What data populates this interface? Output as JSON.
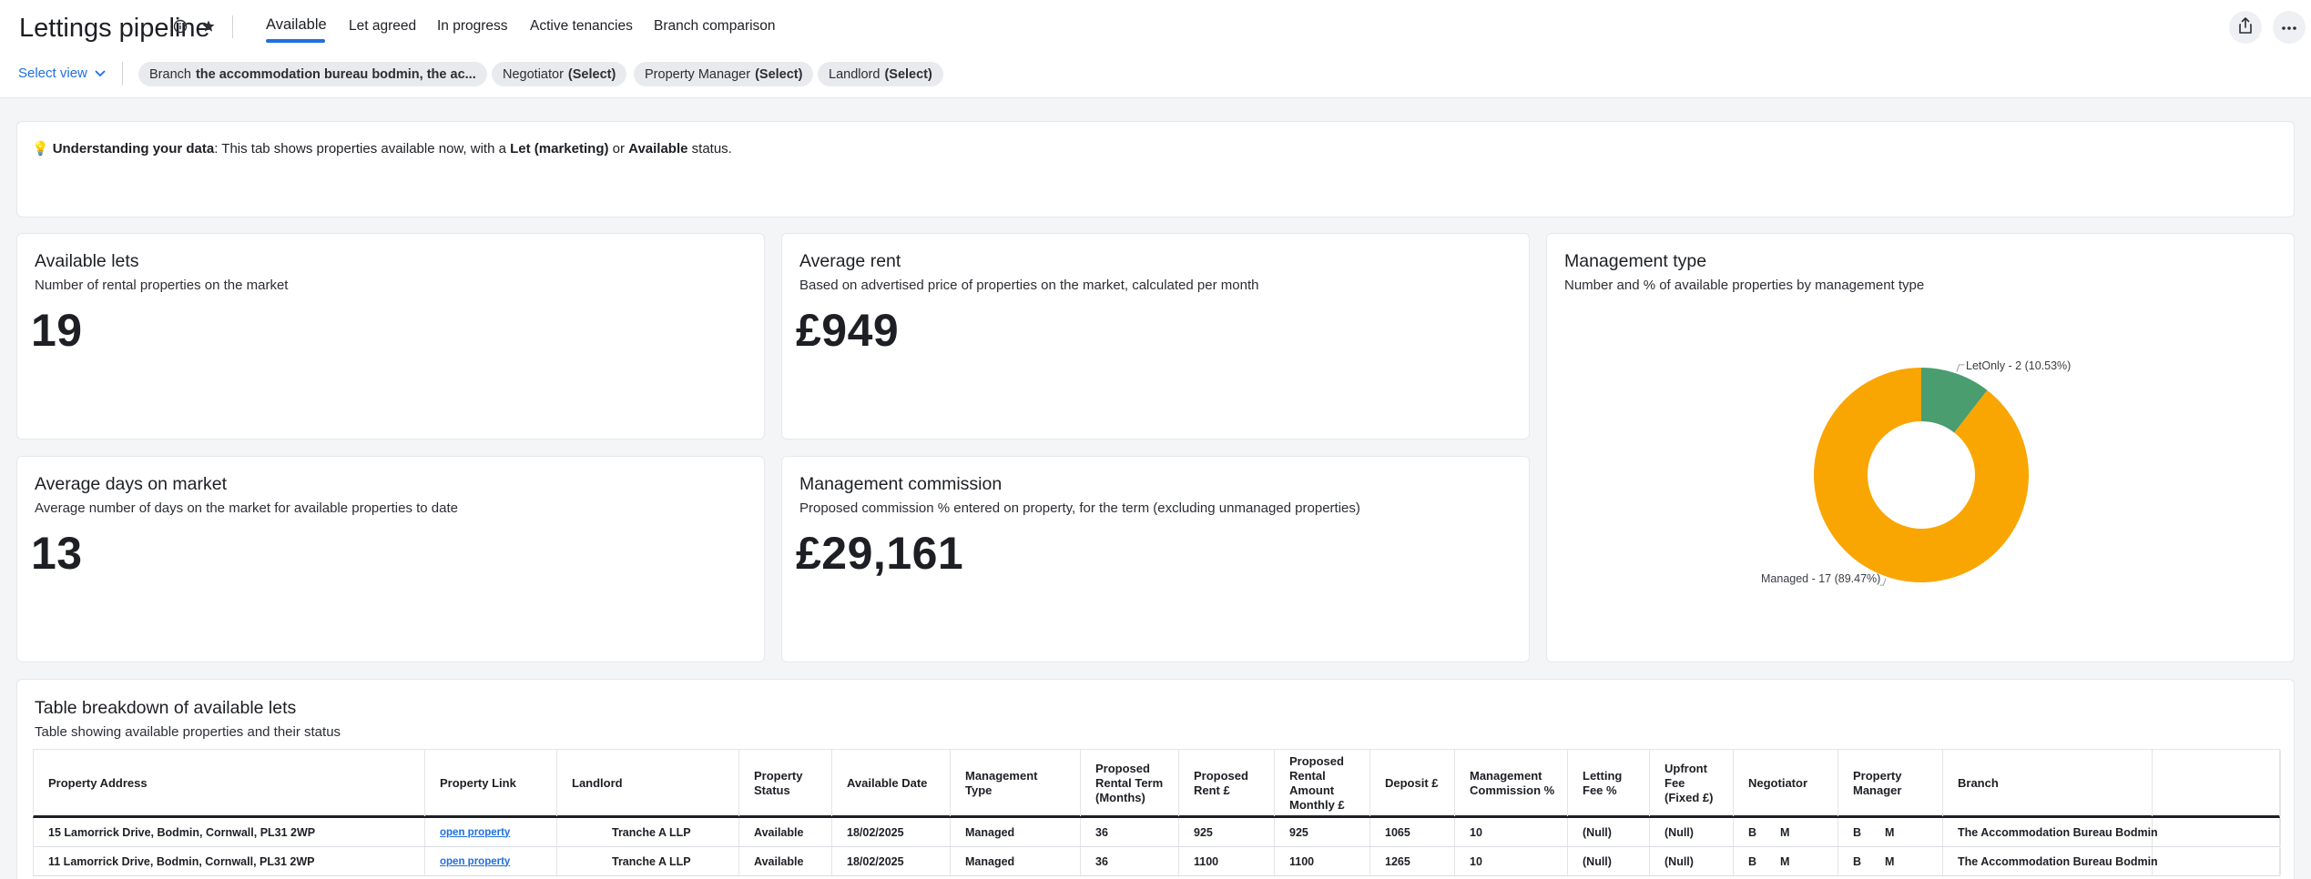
{
  "header": {
    "title": "Lettings pipeline",
    "tabs": [
      "Available",
      "Let agreed",
      "In progress",
      "Active tenancies",
      "Branch comparison"
    ],
    "active_tab": "Available"
  },
  "filters": {
    "select_view": "Select view",
    "chips": [
      {
        "label": "Branch",
        "value": "the accommodation bureau bodmin, the ac..."
      },
      {
        "label": "Negotiator",
        "value": "(Select)"
      },
      {
        "label": "Property Manager",
        "value": "(Select)"
      },
      {
        "label": "Landlord",
        "value": "(Select)"
      }
    ]
  },
  "info": {
    "bulb": "💡",
    "lead": "Understanding your data",
    "text1": ": This tab shows properties available now, with a ",
    "bold1": "Let (marketing)",
    "text2": " or ",
    "bold2": "Available",
    "text3": " status."
  },
  "kpis": {
    "available_lets": {
      "title": "Available lets",
      "subtitle": "Number of rental properties on the market",
      "value": "19"
    },
    "average_rent": {
      "title": "Average rent",
      "subtitle": "Based on advertised price of properties on the market, calculated per month",
      "value": "£949"
    },
    "average_days": {
      "title": "Average days on market",
      "subtitle": "Average number of days on the market for available properties to date",
      "value": "13"
    },
    "management_commission": {
      "title": "Management commission",
      "subtitle": "Proposed commission % entered on property, for the term (excluding unmanaged properties)",
      "value": "£29,161"
    }
  },
  "management_type": {
    "title": "Management type",
    "subtitle": "Number and % of available properties by management type"
  },
  "chart_data": {
    "type": "pie",
    "title": "Management type",
    "subtitle": "Number and % of available properties by management type",
    "donut": true,
    "slices": [
      {
        "name": "LetOnly",
        "value": 2,
        "percent": 10.53,
        "label": "LetOnly - 2 (10.53%)",
        "color": "#4a9d6f"
      },
      {
        "name": "Managed",
        "value": 17,
        "percent": 89.47,
        "label": "Managed - 17 (89.47%)",
        "color": "#f9a602"
      }
    ]
  },
  "table": {
    "title": "Table breakdown of available lets",
    "subtitle": "Table showing available properties and their status",
    "columns": [
      [
        "Property Address"
      ],
      [
        "Property Link"
      ],
      [
        "Landlord"
      ],
      [
        "Property",
        "Status"
      ],
      [
        "Available Date"
      ],
      [
        "Management",
        "Type"
      ],
      [
        "Proposed",
        "Rental Term",
        "(Months)"
      ],
      [
        "Proposed",
        "Rent £"
      ],
      [
        "Proposed",
        "Rental",
        "Amount",
        "Monthly £"
      ],
      [
        "Deposit £"
      ],
      [
        "Management",
        "Commission %"
      ],
      [
        "Letting",
        "Fee %"
      ],
      [
        "Upfront",
        "Fee",
        "(Fixed £)"
      ],
      [
        "Negotiator"
      ],
      [
        "Property",
        "Manager"
      ],
      [
        "Branch"
      ],
      [
        ""
      ]
    ],
    "rows": [
      [
        "15 Lamorrick Drive, Bodmin, Cornwall, PL31 2WP",
        "open property",
        "Tranche A LLP",
        "Available",
        "18/02/2025",
        "Managed",
        "36",
        "925",
        "925",
        "1065",
        "10",
        "(Null)",
        "(Null)",
        [
          "B",
          "M"
        ],
        [
          "B",
          "M"
        ],
        "The Accommodation Bureau Bodmin",
        ""
      ],
      [
        "11 Lamorrick Drive, Bodmin, Cornwall, PL31 2WP",
        "open property",
        "Tranche A LLP",
        "Available",
        "18/02/2025",
        "Managed",
        "36",
        "1100",
        "1100",
        "1265",
        "10",
        "(Null)",
        "(Null)",
        [
          "B",
          "M"
        ],
        [
          "B",
          "M"
        ],
        "The Accommodation Bureau Bodmin",
        ""
      ]
    ]
  },
  "colors": {
    "accent": "#1f6fe0",
    "letonly": "#4a9d6f",
    "managed": "#f9a602"
  }
}
